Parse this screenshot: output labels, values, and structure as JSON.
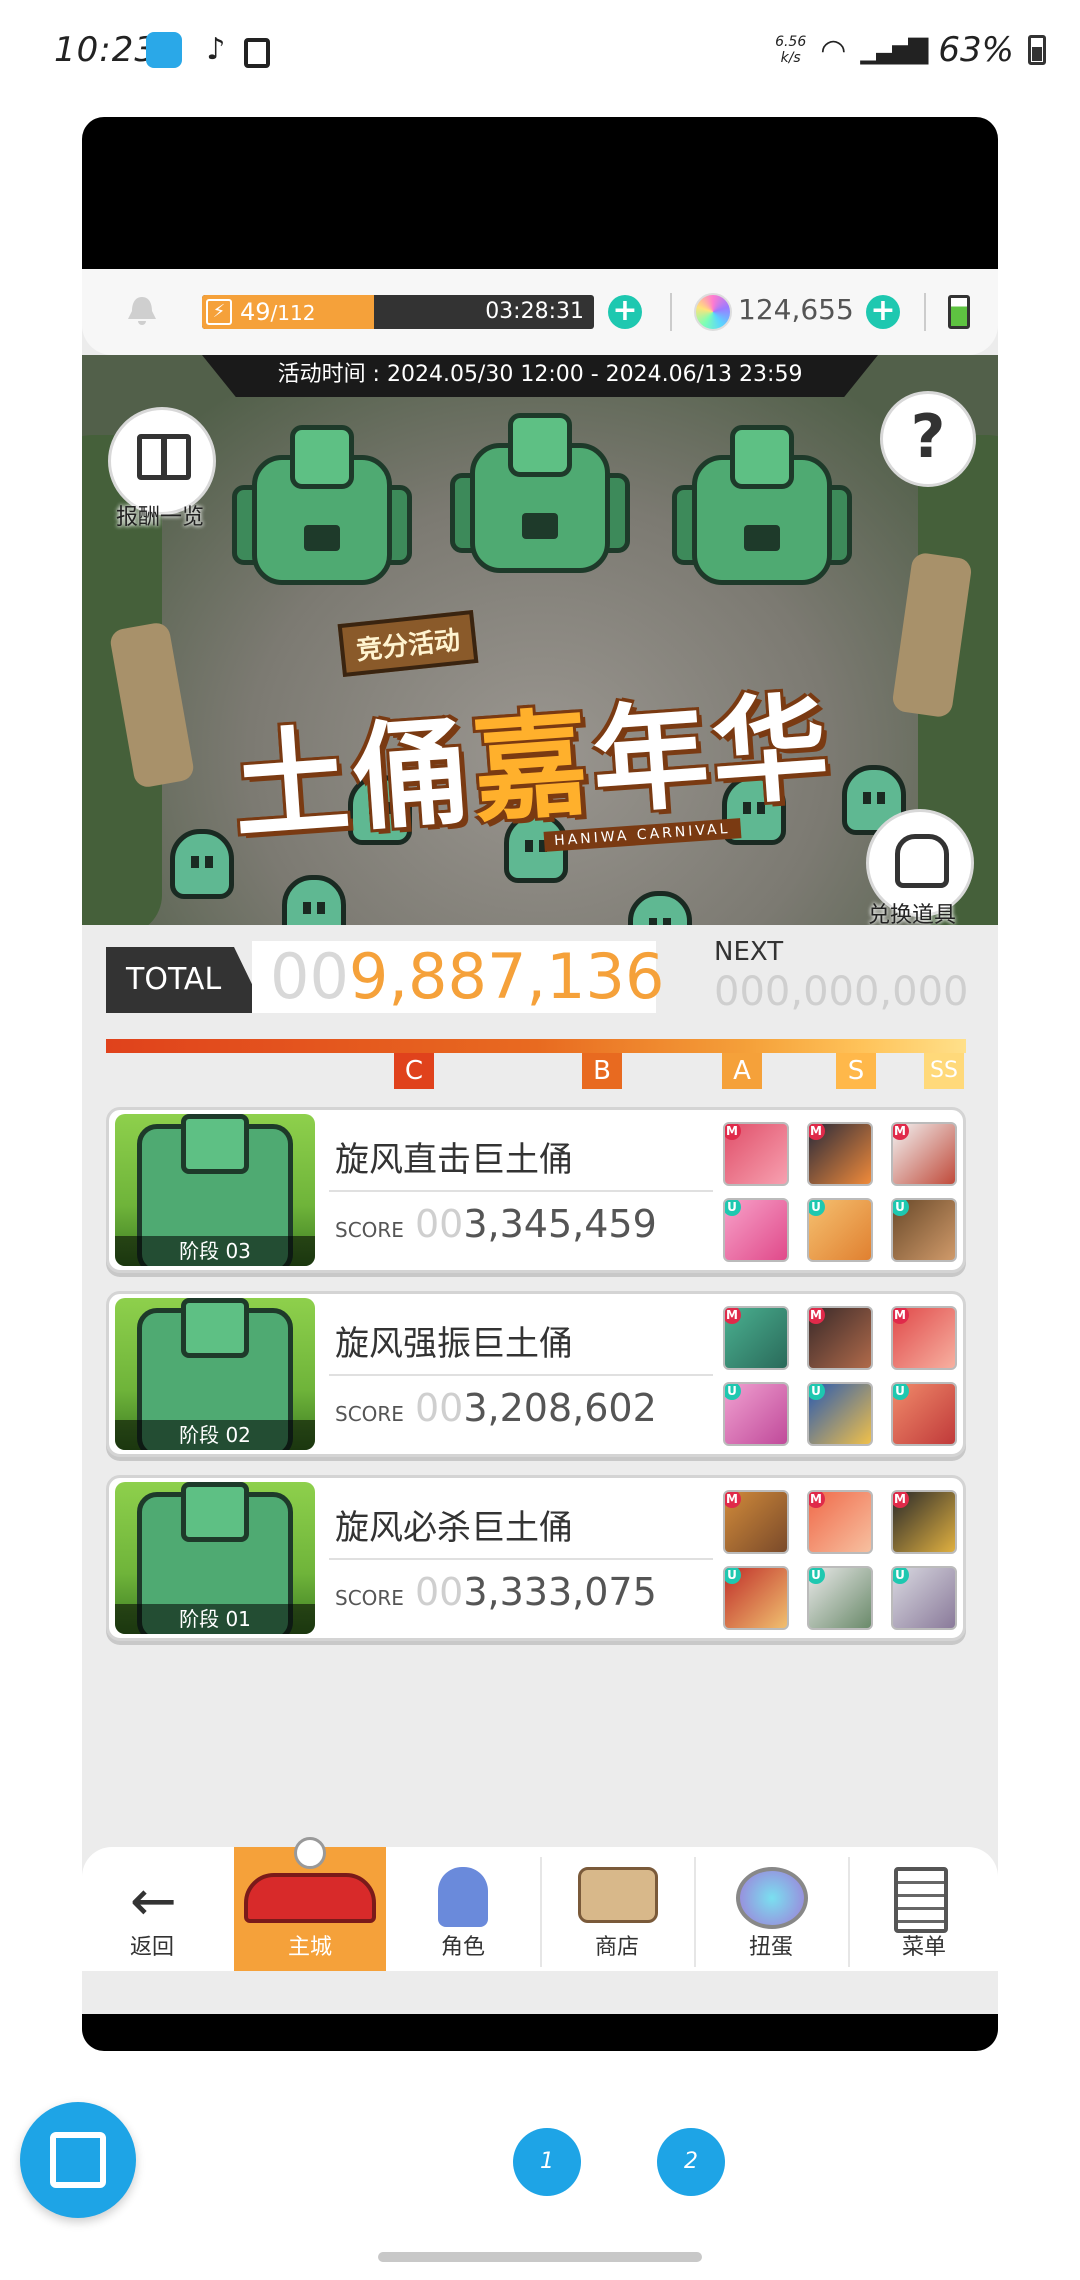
{
  "status_bar": {
    "time": "10:23",
    "net_speed_top": "6.56",
    "net_speed_bottom": "k/s",
    "battery": "63%"
  },
  "resources": {
    "stamina_current": "49",
    "stamina_max": "/112",
    "stamina_fraction": 0.44,
    "stamina_timer": "03:28:31",
    "gems": "124,655"
  },
  "banner": {
    "event_time": "活动时间 : 2024.05/30 12:00 - 2024.06/13 23:59",
    "logo_sub": "竞分活动",
    "logo_main_a": "土俑",
    "logo_main_b": "嘉",
    "logo_main_c": "年华",
    "logo_en": "HANIWA CARNIVAL",
    "rewards_label": "报酬一览",
    "exchange_label": "兑换道具"
  },
  "score": {
    "total_label": "TOTAL",
    "total_zeros": "00",
    "total_value": "9,887,136",
    "next_label": "NEXT",
    "next_value": "000,000,000",
    "ranks": [
      "C",
      "B",
      "A",
      "S",
      "SS"
    ]
  },
  "bosses": [
    {
      "name": "旋风直击巨土俑",
      "stage": "阶段 03",
      "score_label": "SCORE",
      "score_zeros": "00",
      "score": "3,345,459"
    },
    {
      "name": "旋风强振巨土俑",
      "stage": "阶段 02",
      "score_label": "SCORE",
      "score_zeros": "00",
      "score": "3,208,602"
    },
    {
      "name": "旋风必杀巨土俑",
      "stage": "阶段 01",
      "score_label": "SCORE",
      "score_zeros": "00",
      "score": "3,333,075"
    }
  ],
  "party_badges": {
    "top": "M",
    "bottom": "U"
  },
  "nav": {
    "back": "返回",
    "main_city": "主城",
    "characters": "角色",
    "shop": "商店",
    "gacha": "扭蛋",
    "menu": "菜单"
  },
  "pages": [
    "1",
    "2"
  ],
  "colors": {
    "accent_orange": "#f5a13a",
    "teal_plus": "#1ec8b0",
    "float_blue": "#1ea4e6"
  }
}
